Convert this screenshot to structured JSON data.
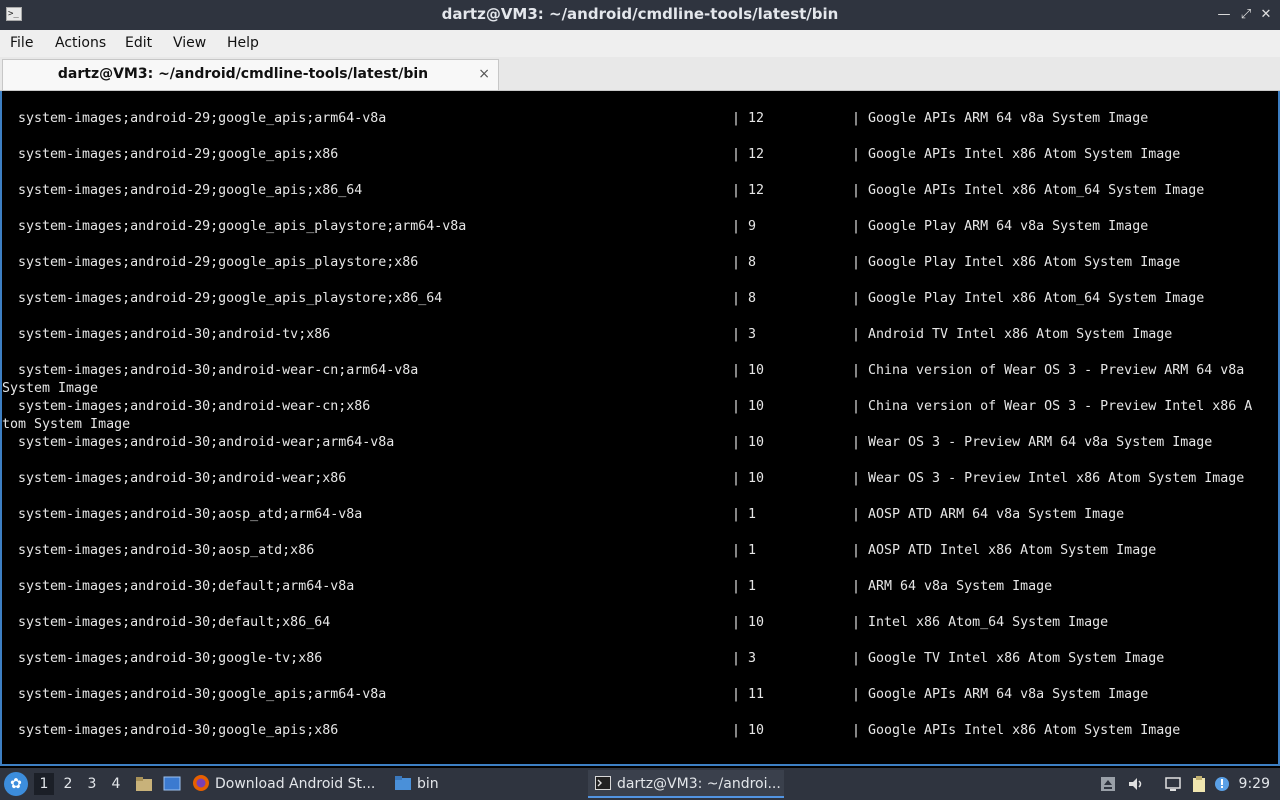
{
  "window": {
    "title": "dartz@VM3: ~/android/cmdline-tools/latest/bin"
  },
  "menu": [
    "File",
    "Actions",
    "Edit",
    "View",
    "Help"
  ],
  "tab": {
    "label": "dartz@VM3: ~/android/cmdline-tools/latest/bin",
    "close": "×"
  },
  "terminal_rows": [
    {
      "pkg": "system-images;android-29;google_apis;arm64-v8a",
      "ver": "| 12",
      "desc": "| Google APIs ARM 64 v8a System Image",
      "wrap": ""
    },
    {
      "pkg": "system-images;android-29;google_apis;x86",
      "ver": "| 12",
      "desc": "| Google APIs Intel x86 Atom System Image",
      "wrap": ""
    },
    {
      "pkg": "system-images;android-29;google_apis;x86_64",
      "ver": "| 12",
      "desc": "| Google APIs Intel x86 Atom_64 System Image",
      "wrap": ""
    },
    {
      "pkg": "system-images;android-29;google_apis_playstore;arm64-v8a",
      "ver": "| 9",
      "desc": "| Google Play ARM 64 v8a System Image",
      "wrap": ""
    },
    {
      "pkg": "system-images;android-29;google_apis_playstore;x86",
      "ver": "| 8",
      "desc": "| Google Play Intel x86 Atom System Image",
      "wrap": ""
    },
    {
      "pkg": "system-images;android-29;google_apis_playstore;x86_64",
      "ver": "| 8",
      "desc": "| Google Play Intel x86 Atom_64 System Image",
      "wrap": ""
    },
    {
      "pkg": "system-images;android-30;android-tv;x86",
      "ver": "| 3",
      "desc": "| Android TV Intel x86 Atom System Image",
      "wrap": ""
    },
    {
      "pkg": "system-images;android-30;android-wear-cn;arm64-v8a",
      "ver": "| 10",
      "desc": "| China version of Wear OS 3 - Preview ARM 64 v8a",
      "wrap": "System Image"
    },
    {
      "pkg": "system-images;android-30;android-wear-cn;x86",
      "ver": "| 10",
      "desc": "| China version of Wear OS 3 - Preview Intel x86 A",
      "wrap": "tom System Image"
    },
    {
      "pkg": "system-images;android-30;android-wear;arm64-v8a",
      "ver": "| 10",
      "desc": "| Wear OS 3 - Preview ARM 64 v8a System Image",
      "wrap": ""
    },
    {
      "pkg": "system-images;android-30;android-wear;x86",
      "ver": "| 10",
      "desc": "| Wear OS 3 - Preview Intel x86 Atom System Image",
      "wrap": ""
    },
    {
      "pkg": "system-images;android-30;aosp_atd;arm64-v8a",
      "ver": "| 1",
      "desc": "| AOSP ATD ARM 64 v8a System Image",
      "wrap": ""
    },
    {
      "pkg": "system-images;android-30;aosp_atd;x86",
      "ver": "| 1",
      "desc": "| AOSP ATD Intel x86 Atom System Image",
      "wrap": ""
    },
    {
      "pkg": "system-images;android-30;default;arm64-v8a",
      "ver": "| 1",
      "desc": "| ARM 64 v8a System Image",
      "wrap": ""
    },
    {
      "pkg": "system-images;android-30;default;x86_64",
      "ver": "| 10",
      "desc": "| Intel x86 Atom_64 System Image",
      "wrap": ""
    },
    {
      "pkg": "system-images;android-30;google-tv;x86",
      "ver": "| 3",
      "desc": "| Google TV Intel x86 Atom System Image",
      "wrap": ""
    },
    {
      "pkg": "system-images;android-30;google_apis;arm64-v8a",
      "ver": "| 11",
      "desc": "| Google APIs ARM 64 v8a System Image",
      "wrap": ""
    },
    {
      "pkg": "system-images;android-30;google_apis;x86",
      "ver": "| 10",
      "desc": "| Google APIs Intel x86 Atom System Image",
      "wrap": ""
    }
  ],
  "taskbar": {
    "workspaces": [
      "1",
      "2",
      "3",
      "4"
    ],
    "tasks": [
      {
        "label": "Download Android St...",
        "icon": "firefox-icon"
      },
      {
        "label": "bin",
        "icon": "folder-icon"
      },
      {
        "label": "dartz@VM3: ~/androi...",
        "icon": "terminal-icon"
      }
    ],
    "clock": "9:29"
  },
  "colors": {
    "titlebar": "#2f343f",
    "terminal_bg": "#000000",
    "terminal_fg": "#e6e6e6",
    "focus_border": "#3d7fc3",
    "accent": "#5294e2"
  }
}
